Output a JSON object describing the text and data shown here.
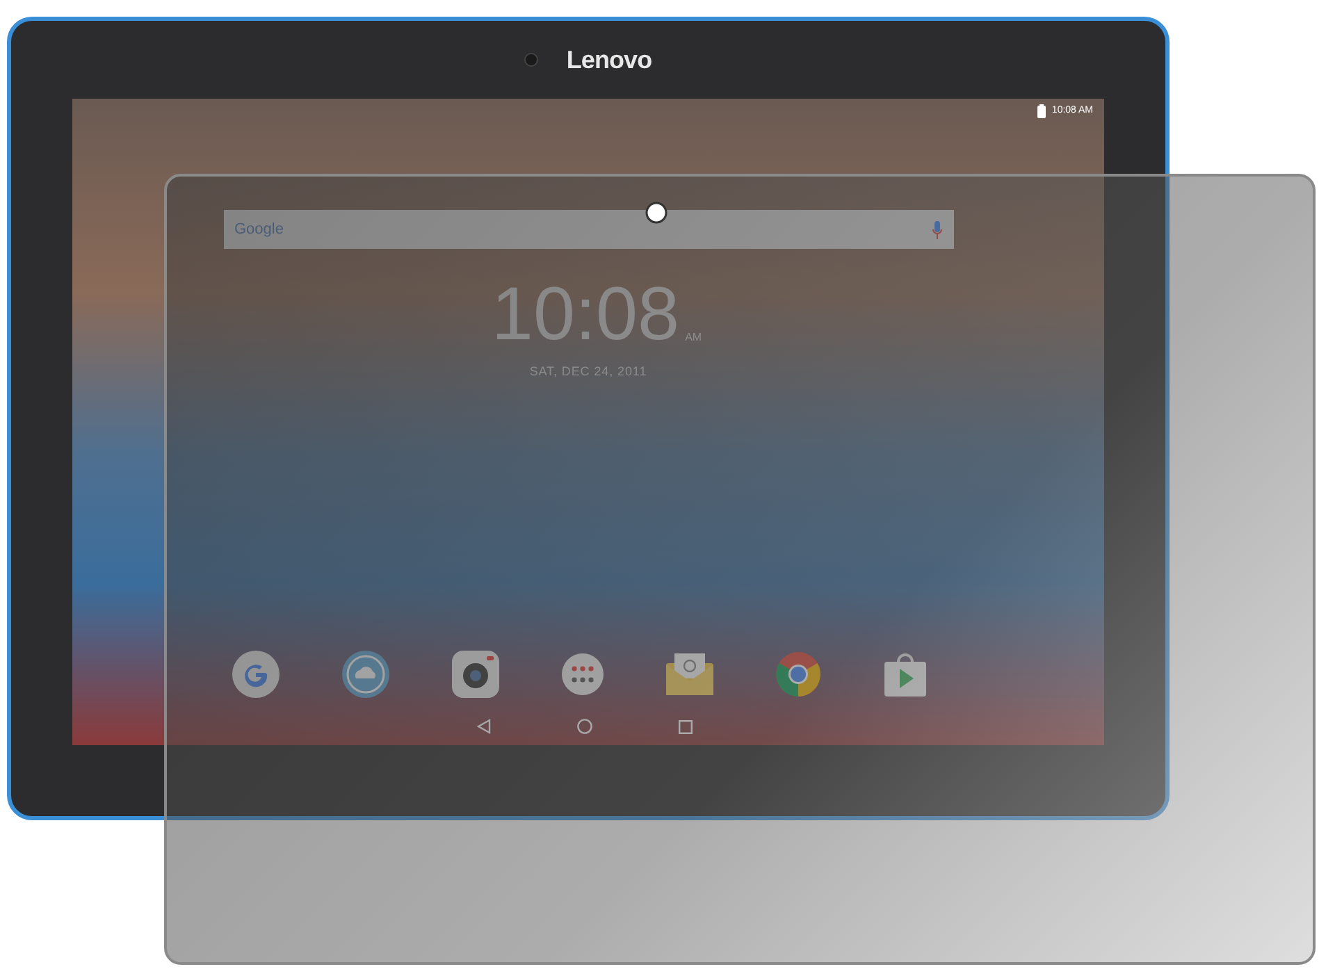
{
  "device": {
    "brand": "Lenovo"
  },
  "status_bar": {
    "time": "10:08 AM"
  },
  "search": {
    "logo": "Google"
  },
  "clock": {
    "time": "10:08",
    "period": "AM",
    "date": "SAT, DEC 24, 2011"
  }
}
